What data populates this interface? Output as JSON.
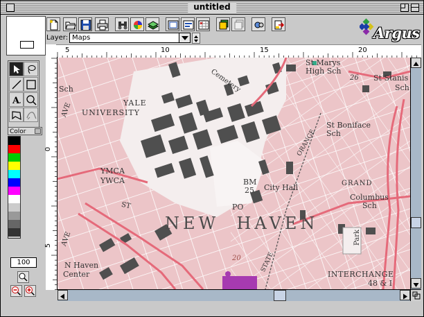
{
  "window": {
    "title": "untitled"
  },
  "toolbar": {
    "buttons": [
      "new-document-icon",
      "open-folder-icon",
      "save-disk-icon",
      "print-icon",
      "binoculars-icon",
      "color-wheel-icon",
      "layers-book-icon",
      "frame-icon",
      "text-frame-icon",
      "grid-xyz-icon",
      "stack-layers-icon",
      "stack-layers-faded-icon",
      "globe-connect-icon",
      "export-icon"
    ]
  },
  "layer": {
    "label": "Layer:",
    "value": "Maps"
  },
  "logo": {
    "text": "Argus",
    "colors": [
      "#1a3fa8",
      "#2ea043",
      "#d4c21a",
      "#8a2aa8"
    ]
  },
  "tools": [
    "arrow-select-icon",
    "lasso-icon",
    "line-icon",
    "rectangle-icon",
    "text-tool-icon",
    "magnify-tool-icon",
    "polygon-icon",
    "freeform-icon"
  ],
  "color_palette": {
    "label": "Color",
    "swatches": [
      "#000000",
      "#ff0000",
      "#00cc00",
      "#ffff00",
      "#00ffff",
      "#0000ff",
      "#ff00ff",
      "#ffffff",
      "#cccccc",
      "#999999",
      "#666666",
      "#333333"
    ]
  },
  "zoom": {
    "value": "100"
  },
  "ruler": {
    "h_labels": [
      "5",
      "10",
      "15",
      "20"
    ],
    "v_labels": [
      "0",
      "5"
    ]
  },
  "map": {
    "labels": {
      "st_marys": "St Marys",
      "high_sch": "High Sch",
      "st_stanis": "St Stanis",
      "sch1": "Sch",
      "cemetery": "Cemetery",
      "yale": "YALE",
      "university": "UNIVERSITY",
      "st_boniface": "St Boniface",
      "sch2": "Sch",
      "sch3": "Sch",
      "ymca": "YMCA",
      "ywca": "YWCA",
      "bm": "BM",
      "bm_num": "25",
      "city_hall": "City Hall",
      "grand": "GRAND",
      "columbus": "Columbus",
      "sch4": "Sch",
      "po": "PO",
      "new_haven": "NEW  HAVEN",
      "park": "Park",
      "st": "ST",
      "n_haven": "N Haven",
      "center": "Center",
      "interchange": "INTERCHANGE",
      "exit_nums": "48 & I",
      "twenty": "20",
      "twenty_six": "26",
      "orange": "ORANGE",
      "state": "STATE",
      "ave1": "AVE",
      "ave2": "AVE"
    }
  }
}
